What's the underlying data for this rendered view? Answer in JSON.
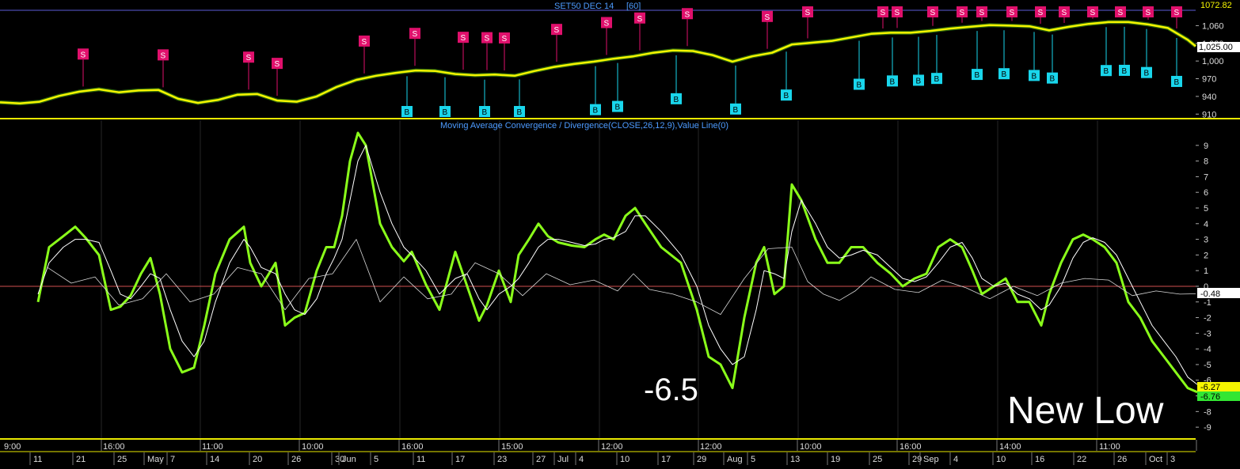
{
  "colors": {
    "background": "#000000",
    "price_line": "#f5f500",
    "macd_line": "#8aff1a",
    "signal_line": "#ffffff",
    "separator": "#e8e800",
    "sell_marker": "#e0106c",
    "buy_marker": "#19d6ec",
    "title_text": "#4d9bff",
    "zero_line": "#d05050",
    "grid": "#262626",
    "axis_text": "#dcdcdc"
  },
  "chart_data": [
    {
      "type": "line",
      "title": "SET50 DEC 14",
      "title_suffix": "[60]",
      "y_ticks": [
        "1,060",
        "1,030",
        "1,000",
        "970",
        "940",
        "910"
      ],
      "ylim": [
        905,
        1082
      ],
      "last_value": "1,025.00",
      "high_value": "1072.82",
      "series": [
        {
          "x": [
            0,
            25,
            50,
            75,
            100,
            125,
            150,
            175,
            200,
            225,
            250,
            275,
            300,
            325,
            350,
            375,
            400,
            425,
            450,
            475,
            500,
            525,
            550,
            575,
            600,
            625,
            650,
            675,
            700,
            725,
            750,
            775,
            800,
            825,
            850,
            875,
            900,
            925,
            950,
            975,
            1000,
            1025,
            1050,
            1075,
            1100,
            1125,
            1150,
            1175,
            1200,
            1225,
            1250,
            1275,
            1300,
            1325,
            1350,
            1375,
            1400,
            1425,
            1450,
            1475,
            1500,
            1510
          ],
          "values": [
            930,
            928,
            931,
            941,
            948,
            952,
            947,
            950,
            951,
            936,
            929,
            934,
            943,
            944,
            933,
            931,
            940,
            956,
            968,
            975,
            980,
            984,
            983,
            978,
            976,
            977,
            975,
            983,
            990,
            995,
            999,
            1004,
            1008,
            1014,
            1018,
            1017,
            1010,
            999,
            1008,
            1014,
            1028,
            1031,
            1034,
            1040,
            1046,
            1048,
            1048,
            1051,
            1055,
            1058,
            1061,
            1060,
            1059,
            1052,
            1058,
            1063,
            1066,
            1066,
            1062,
            1056,
            1036,
            1025
          ]
        }
      ],
      "sell_signals_x": [
        105,
        206,
        314,
        350,
        460,
        524,
        585,
        615,
        637,
        703,
        766,
        808,
        868,
        969,
        1020,
        1115,
        1133,
        1178,
        1215,
        1240,
        1278,
        1314,
        1344,
        1380,
        1415,
        1450,
        1486
      ],
      "buy_signals_x": [
        514,
        562,
        612,
        656,
        752,
        780,
        854,
        929,
        993,
        1085,
        1127,
        1160,
        1183,
        1234,
        1268,
        1306,
        1329,
        1397,
        1420,
        1448,
        1486
      ]
    },
    {
      "type": "line",
      "title": "Moving Average Convergence / Divergence(CLOSE,26,12,9),Value Line(0)",
      "y_ticks": [
        "9",
        "8",
        "7",
        "6",
        "5",
        "4",
        "3",
        "2",
        "1",
        "0",
        "-1",
        "-2",
        "-3",
        "-4",
        "-5",
        "-6",
        "-7",
        "-8",
        "-9"
      ],
      "ylim": [
        -9.6,
        9.9
      ],
      "last_values": [
        "-0.48",
        "-6.27",
        "-6.76"
      ],
      "annotation_low": "-6.5",
      "annotation_text": "New Low",
      "series": [
        {
          "role": "macd",
          "x": [
            48,
            62,
            80,
            95,
            108,
            125,
            140,
            152,
            165,
            178,
            190,
            202,
            215,
            230,
            245,
            258,
            272,
            290,
            308,
            316,
            330,
            348,
            360,
            372,
            385,
            400,
            412,
            422,
            432,
            442,
            452,
            462,
            480,
            495,
            510,
            520,
            538,
            555,
            575,
            590,
            605,
            615,
            630,
            645,
            655,
            668,
            680,
            692,
            705,
            722,
            738,
            752,
            763,
            775,
            790,
            802,
            815,
            835,
            860,
            880,
            895,
            910,
            925,
            940,
            955,
            965,
            978,
            990,
            1000,
            1012,
            1030,
            1045,
            1060,
            1075,
            1090,
            1108,
            1125,
            1140,
            1155,
            1170,
            1185,
            1200,
            1215,
            1228,
            1240,
            1255,
            1270,
            1285,
            1300,
            1315,
            1325,
            1340,
            1355,
            1368,
            1380,
            1395,
            1410,
            1425,
            1440,
            1455,
            1470,
            1485,
            1500,
            1512
          ],
          "values": [
            -1,
            2.5,
            3.2,
            3.8,
            3.1,
            2.0,
            -1.5,
            -1.3,
            -0.6,
            0.8,
            1.8,
            -0.5,
            -4.0,
            -5.5,
            -5.2,
            -2.5,
            0.8,
            3.0,
            3.8,
            1.5,
            0.0,
            1.5,
            -2.5,
            -2.0,
            -1.7,
            1.0,
            2.5,
            2.5,
            4.5,
            8.0,
            9.8,
            9.0,
            4.0,
            2.5,
            1.6,
            2.2,
            0.1,
            -1.5,
            2.2,
            0.0,
            -2.2,
            -1.2,
            1.0,
            -1.0,
            2.0,
            3.0,
            4.0,
            3.2,
            2.8,
            2.6,
            2.5,
            3.0,
            3.3,
            3.0,
            4.5,
            5.0,
            4.0,
            2.5,
            1.5,
            -1.5,
            -4.5,
            -5.0,
            -6.5,
            -2.0,
            1.5,
            2.5,
            -0.5,
            0.0,
            6.5,
            5.5,
            3.0,
            1.5,
            1.5,
            2.5,
            2.5,
            1.5,
            0.8,
            0.0,
            0.5,
            0.8,
            2.5,
            3.0,
            2.5,
            1.0,
            -0.5,
            0.0,
            0.5,
            -1.0,
            -1.0,
            -2.5,
            -0.5,
            1.5,
            3.0,
            3.3,
            3.0,
            2.5,
            1.5,
            -1.0,
            -2.0,
            -3.5,
            -4.5,
            -5.5,
            -6.5,
            -6.76
          ]
        },
        {
          "role": "signal",
          "x": [
            48,
            62,
            80,
            95,
            108,
            125,
            140,
            152,
            165,
            178,
            190,
            202,
            215,
            230,
            245,
            258,
            272,
            290,
            308,
            316,
            330,
            348,
            360,
            372,
            385,
            400,
            412,
            422,
            432,
            442,
            452,
            462,
            480,
            495,
            510,
            520,
            538,
            555,
            575,
            590,
            605,
            615,
            630,
            645,
            655,
            668,
            680,
            692,
            705,
            722,
            738,
            752,
            763,
            775,
            790,
            802,
            815,
            835,
            860,
            880,
            895,
            910,
            925,
            940,
            955,
            965,
            978,
            990,
            1000,
            1012,
            1030,
            1045,
            1060,
            1075,
            1090,
            1108,
            1125,
            1140,
            1155,
            1170,
            1185,
            1200,
            1215,
            1228,
            1240,
            1255,
            1270,
            1285,
            1300,
            1315,
            1325,
            1340,
            1355,
            1368,
            1380,
            1395,
            1410,
            1425,
            1440,
            1455,
            1470,
            1485,
            1500,
            1512
          ],
          "values": [
            -0.5,
            1.5,
            2.5,
            3.0,
            3.0,
            2.8,
            1.0,
            -0.5,
            -0.8,
            0.0,
            0.8,
            0.5,
            -1.5,
            -3.5,
            -4.5,
            -3.5,
            -1.0,
            1.5,
            3.0,
            2.5,
            1.2,
            0.8,
            -0.5,
            -1.5,
            -1.8,
            -0.8,
            0.8,
            1.8,
            3.0,
            5.5,
            8.0,
            9.0,
            6.0,
            4.0,
            2.5,
            2.0,
            1.0,
            -0.5,
            0.5,
            0.8,
            -0.8,
            -1.5,
            -0.5,
            0.0,
            0.5,
            1.5,
            2.5,
            3.0,
            3.0,
            2.8,
            2.6,
            2.7,
            3.0,
            3.1,
            3.5,
            4.5,
            4.5,
            3.5,
            2.0,
            0.0,
            -2.5,
            -4.0,
            -5.0,
            -4.5,
            -1.5,
            1.0,
            0.8,
            0.5,
            3.5,
            5.5,
            4.0,
            2.5,
            1.8,
            2.0,
            2.3,
            2.0,
            1.2,
            0.5,
            0.3,
            0.6,
            1.5,
            2.5,
            2.8,
            1.8,
            0.5,
            0.0,
            0.2,
            -0.5,
            -0.8,
            -1.5,
            -1.2,
            0.0,
            1.8,
            2.8,
            3.1,
            2.8,
            2.0,
            0.5,
            -1.0,
            -2.5,
            -3.5,
            -4.5,
            -5.8,
            -6.27
          ]
        },
        {
          "role": "histogram",
          "x": [
            60,
            90,
            120,
            150,
            180,
            210,
            240,
            270,
            300,
            330,
            360,
            390,
            420,
            450,
            480,
            510,
            540,
            570,
            600,
            630,
            660,
            690,
            720,
            750,
            780,
            800,
            820,
            850,
            880,
            910,
            940,
            970,
            1000,
            1020,
            1040,
            1060,
            1080,
            1100,
            1130,
            1160,
            1190,
            1220,
            1250,
            1280,
            1310,
            1340,
            1370,
            1400,
            1430,
            1460,
            1490,
            1510
          ],
          "values": [
            1.2,
            0.2,
            0.6,
            -1.2,
            -0.8,
            0.8,
            -1.0,
            -0.5,
            1.2,
            0.8,
            -1.5,
            0.5,
            0.8,
            3.0,
            -1.0,
            0.6,
            -0.8,
            -0.5,
            1.5,
            0.8,
            -0.6,
            0.8,
            0.1,
            0.4,
            -0.3,
            0.8,
            -0.2,
            -0.5,
            -1.0,
            -1.8,
            0.5,
            2.4,
            2.5,
            0.3,
            -0.5,
            -0.9,
            -0.3,
            0.6,
            -0.2,
            -0.4,
            0.4,
            -0.1,
            -0.8,
            0.0,
            -0.6,
            0.2,
            0.5,
            0.4,
            -0.6,
            -0.3,
            -0.5,
            -0.48
          ]
        }
      ]
    }
  ],
  "time_axis": {
    "hour_labels": [
      "9:00",
      "16:00",
      "11:00",
      "10:00",
      "16:00",
      "15:00",
      "12:00",
      "12:00",
      "10:00",
      "16:00",
      "14:00",
      "11:00"
    ],
    "date_labels": [
      "11",
      "21",
      "25",
      "May",
      "7",
      "14",
      "20",
      "26",
      "30",
      "Jun",
      "5",
      "11",
      "17",
      "23",
      "27",
      "Jul",
      "4",
      "10",
      "17",
      "29",
      "Aug",
      "5",
      "13",
      "19",
      "25",
      "29",
      "Sep",
      "4",
      "10",
      "16",
      "22",
      "26",
      "Oct",
      "3"
    ]
  }
}
